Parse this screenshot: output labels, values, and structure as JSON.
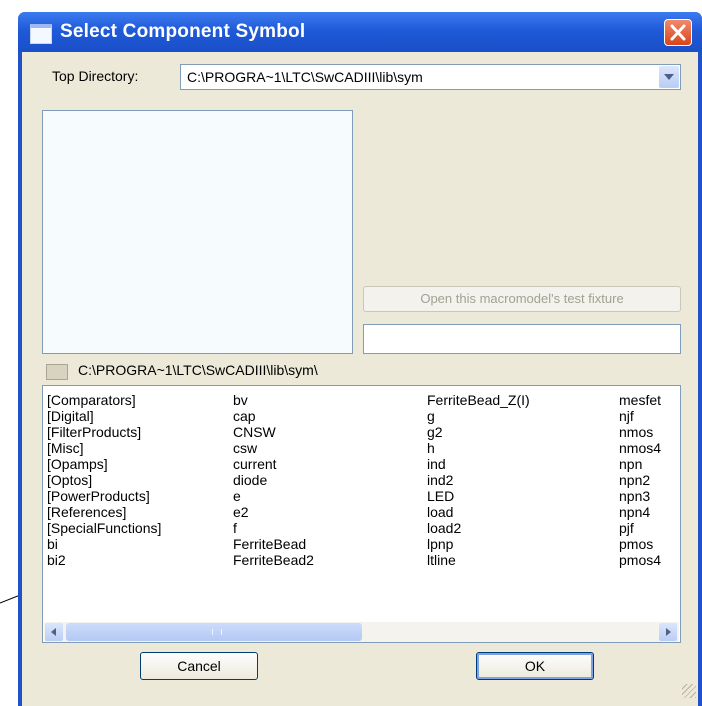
{
  "window": {
    "title": "Select Component Symbol"
  },
  "top_directory": {
    "label": "Top Directory:",
    "value": "C:\\PROGRA~1\\LTC\\SwCADIII\\lib\\sym"
  },
  "macromodel": {
    "open_test_fixture_label": "Open this macromodel's test fixture",
    "field_value": ""
  },
  "current_path": "C:\\PROGRA~1\\LTC\\SwCADIII\\lib\\sym\\",
  "listbox": {
    "columns": [
      [
        "[Comparators]",
        "[Digital]",
        "[FilterProducts]",
        "[Misc]",
        "[Opamps]",
        "[Optos]",
        "[PowerProducts]",
        "[References]",
        "[SpecialFunctions]",
        "bi",
        "bi2"
      ],
      [
        "bv",
        "cap",
        "CNSW",
        "csw",
        "current",
        "diode",
        "e",
        "e2",
        "f",
        "FerriteBead",
        "FerriteBead2"
      ],
      [
        "FerriteBead_Z(I)",
        "g",
        "g2",
        "h",
        "ind",
        "ind2",
        "LED",
        "load",
        "load2",
        "lpnp",
        "ltline"
      ],
      [
        "mesfet",
        "njf",
        "nmos",
        "nmos4",
        "npn",
        "npn2",
        "npn3",
        "npn4",
        "pjf",
        "pmos",
        "pmos4"
      ]
    ]
  },
  "buttons": {
    "cancel": "Cancel",
    "ok": "OK"
  },
  "icons": {
    "title": "window-icon",
    "close": "close-icon",
    "dropdown": "chevron-down-icon",
    "folder": "folder-icon",
    "scroll_left": "arrow-left-icon",
    "scroll_right": "arrow-right-icon",
    "resize": "resize-grip-icon"
  },
  "colors": {
    "titlebar": "#1f5ad8",
    "client_background": "#ece9d8",
    "close_button": "#d9441c",
    "input_border": "#7f9db9"
  }
}
